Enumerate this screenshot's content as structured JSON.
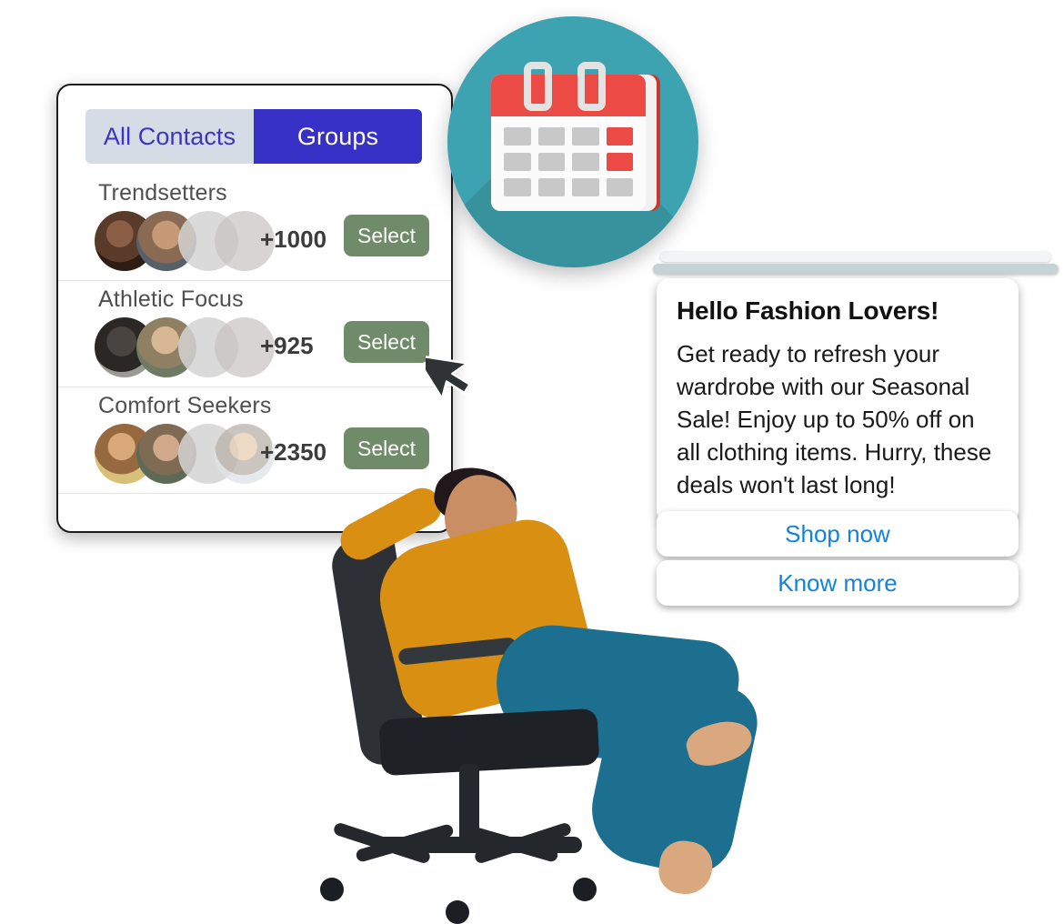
{
  "contacts_panel": {
    "tabs": [
      {
        "label": "All Contacts",
        "active": false
      },
      {
        "label": "Groups",
        "active": true
      }
    ],
    "inactive_tab_bg": "#d6dce6",
    "inactive_tab_text": "#3b35c4",
    "active_tab_bg": "#3730c7",
    "active_tab_text": "#ffffff",
    "groups": [
      {
        "name": "Trendsetters",
        "count": "+1000",
        "select_label": "Select"
      },
      {
        "name": "Athletic Focus",
        "count": "+925",
        "select_label": "Select"
      },
      {
        "name": "Comfort Seekers",
        "count": "+2350",
        "select_label": "Select"
      }
    ],
    "select_button_color": "#6f8b69"
  },
  "calendar_badge": {
    "icon": "calendar-icon",
    "circle_color": "#3ea3b0",
    "header_color": "#ec4a45",
    "page_color": "#fbfbfb",
    "cell_color": "#c8c8c8",
    "highlight_cell_color": "#ec4a45",
    "ring_color": "#e3e3e3",
    "cells": [
      "normal",
      "normal",
      "normal",
      "highlight",
      "normal",
      "normal",
      "normal",
      "highlight",
      "normal",
      "normal",
      "normal",
      "normal"
    ]
  },
  "message_bubble": {
    "title": "Hello Fashion Lovers!",
    "body": "Get ready to refresh your wardrobe with our Seasonal Sale! Enjoy up to 50% off on all clothing items. Hurry, these deals won't last long!",
    "background": "#ffffff",
    "title_color": "#111111",
    "body_color": "#1a1a1a",
    "actions": [
      {
        "label": "Shop now",
        "color": "#1283dc"
      },
      {
        "label": "Know more",
        "color": "#1283dc"
      }
    ]
  },
  "cursor": {
    "icon": "mouse-pointer-icon",
    "color": "#2f3336"
  },
  "person_photo": {
    "description": "woman-reclining-in-office-chair",
    "blouse_color": "#d99012",
    "pants_color": "#1d6f8f",
    "chair_color": "#24282c"
  }
}
